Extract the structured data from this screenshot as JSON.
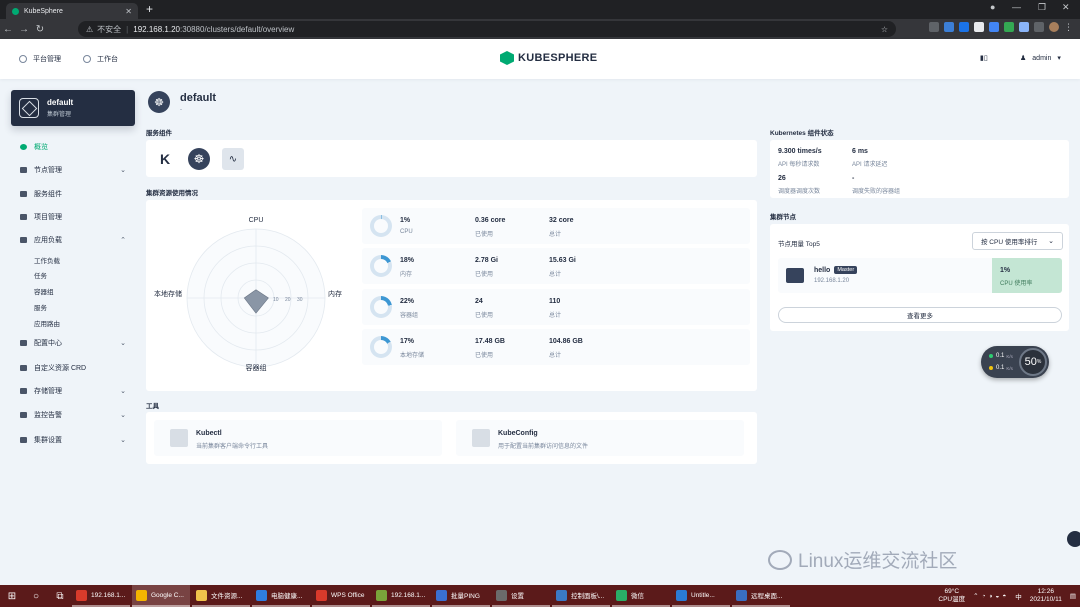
{
  "browser": {
    "tab_title": "KubeSphere",
    "security_label": "不安全",
    "url_host": "192.168.1.20",
    "url_rest": ":30880/clusters/default/overview"
  },
  "topbar": {
    "platform_label": "平台管理",
    "workbench_label": "工作台",
    "logo_text": "KUBESPHERE",
    "user_label": "admin"
  },
  "sidebar": {
    "cluster_name": "default",
    "cluster_sub": "集群管理",
    "items": [
      {
        "label": "概览"
      },
      {
        "label": "节点管理"
      },
      {
        "label": "服务组件"
      },
      {
        "label": "项目管理"
      },
      {
        "label": "应用负载"
      },
      {
        "label": "配置中心"
      },
      {
        "label": "自定义资源 CRD"
      },
      {
        "label": "存储管理"
      },
      {
        "label": "监控告警"
      },
      {
        "label": "集群设置"
      }
    ],
    "sub_items": [
      "工作负载",
      "任务",
      "容器组",
      "服务",
      "应用路由"
    ]
  },
  "main": {
    "title": "default",
    "desc": "-",
    "services_title": "服务组件",
    "resources_title": "集群资源使用情况",
    "radar_labels": {
      "top": "CPU",
      "right": "内存",
      "bottom": "容器组",
      "left": "本地存储"
    },
    "radar_ticks": [
      "10",
      "20",
      "30"
    ],
    "resources": [
      {
        "percent": "1%",
        "name": "CPU",
        "used": "0.36 core",
        "used_label": "已使用",
        "total": "32 core",
        "total_label": "总计",
        "fraction": 0.01
      },
      {
        "percent": "18%",
        "name": "内存",
        "used": "2.78 Gi",
        "used_label": "已使用",
        "total": "15.63 Gi",
        "total_label": "总计",
        "fraction": 0.18
      },
      {
        "percent": "22%",
        "name": "容器组",
        "used": "24",
        "used_label": "已使用",
        "total": "110",
        "total_label": "总计",
        "fraction": 0.22
      },
      {
        "percent": "17%",
        "name": "本地存储",
        "used": "17.48 GB",
        "used_label": "已使用",
        "total": "104.86 GB",
        "total_label": "总计",
        "fraction": 0.17
      }
    ],
    "tools_title": "工具",
    "tools": [
      {
        "name": "Kubectl",
        "desc": "当前集群客户端命令行工具"
      },
      {
        "name": "KubeConfig",
        "desc": "用于配置当前集群访问信息的文件"
      }
    ]
  },
  "k8s_status": {
    "title": "Kubernetes 组件状态",
    "items": [
      {
        "value": "9.300 times/s",
        "label": "API 每秒请求数"
      },
      {
        "value": "6 ms",
        "label": "API 请求延迟"
      },
      {
        "value": "26",
        "label": "调度器调度次数"
      },
      {
        "value": "-",
        "label": "调度失败的容器组"
      }
    ]
  },
  "nodes": {
    "title": "集群节点",
    "header": "节点用量 Top5",
    "sort_label": "按 CPU 使用率排行",
    "node": {
      "name": "hello",
      "role": "Master",
      "ip": "192.168.1.20",
      "usage": "1%",
      "usage_label": "CPU 使用率"
    },
    "more_label": "查看更多"
  },
  "netmon": {
    "up": "0.1",
    "down": "0.1",
    "unit": "K/s",
    "percent": "50",
    "percent_unit": "%"
  },
  "watermark": "Linux运维交流社区",
  "taskbar": {
    "apps": [
      {
        "label": "192.168.1...",
        "color": "#d83b2b"
      },
      {
        "label": "Google C...",
        "color": "#f4b400"
      },
      {
        "label": "文件资源...",
        "color": "#f0c24b"
      },
      {
        "label": "电脑健康...",
        "color": "#2f7de1"
      },
      {
        "label": "WPS Office",
        "color": "#d93a2b"
      },
      {
        "label": "192.168.1...",
        "color": "#7aa43a"
      },
      {
        "label": "批量PING",
        "color": "#3b6fd1"
      },
      {
        "label": "设置",
        "color": "#6b6b6b"
      },
      {
        "label": "控制面板\\...",
        "color": "#3b79c5"
      },
      {
        "label": "微信",
        "color": "#2aae67"
      },
      {
        "label": "Untitle...",
        "color": "#2b7bd4"
      },
      {
        "label": "远程桌面...",
        "color": "#3a6ec1"
      }
    ],
    "temp": "69°C",
    "temp_label": "CPU温度",
    "ime": "中",
    "time": "12:26",
    "date": "2021/10/11"
  },
  "colors": {
    "accent": "#00aa72",
    "dark": "#242e42",
    "bg": "#eff4f9",
    "donut": "#3d97d3"
  }
}
